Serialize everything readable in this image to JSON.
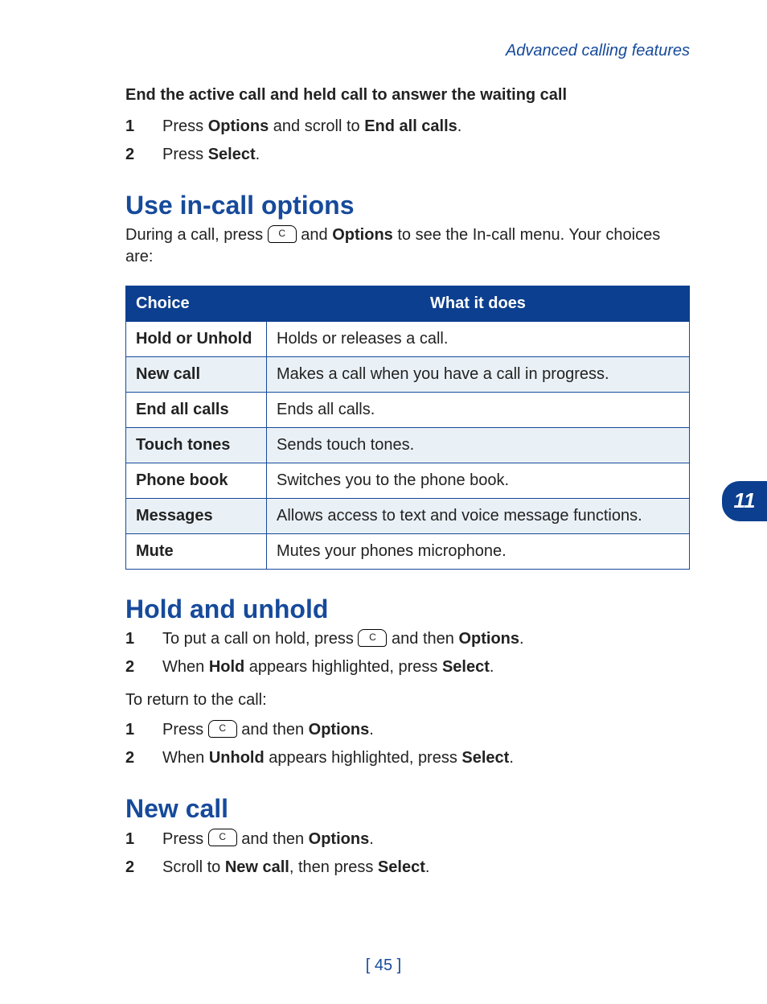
{
  "running_head": "Advanced calling features",
  "chapter_number": "11",
  "page_footer": "[ 45 ]",
  "key_c_label": "C",
  "end_active": {
    "heading": "End the active call and held call to answer the waiting call",
    "step1_pre": "Press ",
    "step1_b1": "Options",
    "step1_mid": " and scroll to ",
    "step1_b2": "End all calls",
    "step1_post": ".",
    "step2_pre": "Press ",
    "step2_b1": "Select",
    "step2_post": "."
  },
  "in_call": {
    "title": "Use in-call options",
    "intro_pre": "During a call, press ",
    "intro_mid": " and ",
    "intro_b": "Options",
    "intro_post": " to see the In-call menu. Your choices are:",
    "col_choice": "Choice",
    "col_what": "What it does",
    "rows": [
      {
        "choice": "Hold or Unhold",
        "what": "Holds or releases a call."
      },
      {
        "choice": "New call",
        "what": "Makes a call when you have a call in progress."
      },
      {
        "choice": "End all calls",
        "what": "Ends all calls."
      },
      {
        "choice": "Touch tones",
        "what": "Sends touch tones."
      },
      {
        "choice": "Phone book",
        "what": "Switches you to the phone book."
      },
      {
        "choice": "Messages",
        "what": "Allows access to text and voice message functions."
      },
      {
        "choice": "Mute",
        "what": "Mutes your phones microphone."
      }
    ]
  },
  "hold_unhold": {
    "title": "Hold and unhold",
    "step1_pre": "To put a call on hold, press ",
    "step1_mid": " and then ",
    "step1_b": "Options",
    "step1_post": ".",
    "step2_pre": "When ",
    "step2_b1": "Hold",
    "step2_mid": " appears highlighted, press ",
    "step2_b2": "Select",
    "step2_post": ".",
    "return_intro": "To return to the call:",
    "rstep1_pre": "Press ",
    "rstep1_mid": " and then ",
    "rstep1_b": "Options",
    "rstep1_post": ".",
    "rstep2_pre": "When ",
    "rstep2_b1": "Unhold",
    "rstep2_mid": " appears highlighted, press ",
    "rstep2_b2": "Select",
    "rstep2_post": "."
  },
  "new_call": {
    "title": "New call",
    "step1_pre": "Press ",
    "step1_mid": " and then ",
    "step1_b": "Options",
    "step1_post": ".",
    "step2_pre": "Scroll to ",
    "step2_b1": "New call",
    "step2_mid": ", then press ",
    "step2_b2": "Select",
    "step2_post": "."
  },
  "step_numbers": {
    "one": "1",
    "two": "2"
  }
}
